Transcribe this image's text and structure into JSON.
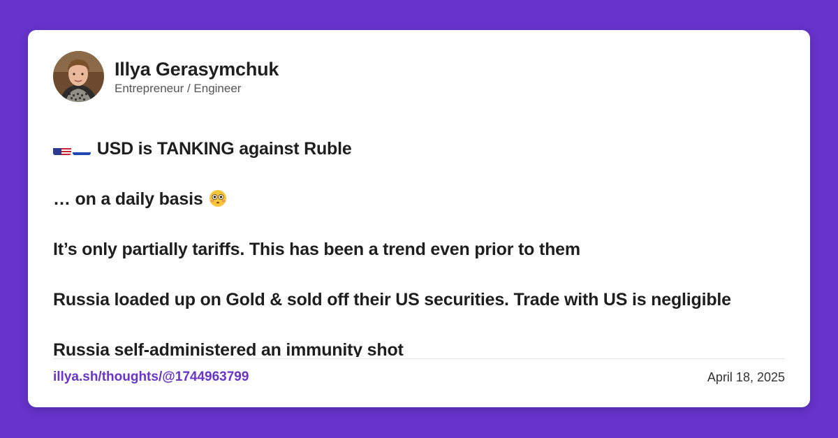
{
  "author": {
    "name": "Illya Gerasymchuk",
    "title": "Entrepreneur / Engineer",
    "avatar_icon": "avatar-photo"
  },
  "post": {
    "lines": [
      "USD is TANKING against Ruble",
      "… on a daily basis",
      "It’s only partially tariffs. This has been a trend even prior to them",
      "Russia loaded up on Gold & sold off their US securities. Trade with US is negligible",
      "Russia self-administered an immunity shot"
    ],
    "leading_icons": [
      "us-flag-icon",
      "russia-flag-icon"
    ],
    "trailing_icon": "flushed-face-emoji-icon"
  },
  "footer": {
    "link": "illya.sh/thoughts/@1744963799",
    "date": "April 18, 2025"
  },
  "colors": {
    "background": "#6633cc",
    "card": "#ffffff",
    "link": "#6a34c9"
  }
}
